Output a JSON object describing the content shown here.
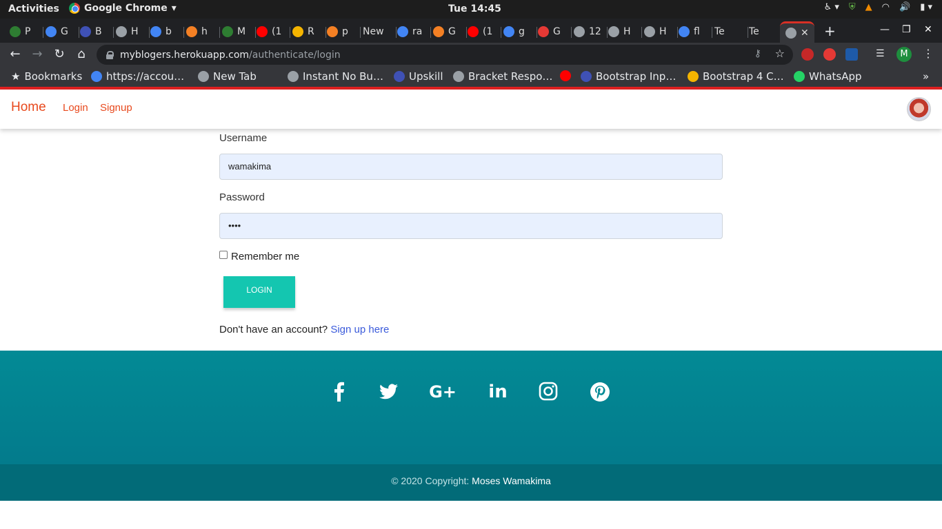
{
  "system_bar": {
    "activities": "Activities",
    "app_name": "Google Chrome",
    "clock": "Tue 14:45"
  },
  "browser": {
    "tabs": [
      {
        "label": "P",
        "fav_color": "#2e7d32"
      },
      {
        "label": "G",
        "fav_color": "#4285f4"
      },
      {
        "label": "B",
        "fav_color": "#3f51b5"
      },
      {
        "label": "H",
        "fav_color": "#9aa0a6"
      },
      {
        "label": "b",
        "fav_color": "#4285f4"
      },
      {
        "label": "h",
        "fav_color": "#f48024"
      },
      {
        "label": "M",
        "fav_color": "#2e7d32"
      },
      {
        "label": "(1",
        "fav_color": "#ff0000"
      },
      {
        "label": "R",
        "fav_color": "#f4b400"
      },
      {
        "label": "p",
        "fav_color": "#f48024"
      },
      {
        "label": "New",
        "fav_color": ""
      },
      {
        "label": "ra",
        "fav_color": "#4285f4"
      },
      {
        "label": "G",
        "fav_color": "#f48024"
      },
      {
        "label": "(1",
        "fav_color": "#ff0000"
      },
      {
        "label": "g",
        "fav_color": "#4285f4"
      },
      {
        "label": "G",
        "fav_color": "#e53935"
      },
      {
        "label": "12",
        "fav_color": "#9aa0a6"
      },
      {
        "label": "H",
        "fav_color": "#9aa0a6"
      },
      {
        "label": "H",
        "fav_color": "#9aa0a6"
      },
      {
        "label": "fl",
        "fav_color": "#4285f4"
      },
      {
        "label": "Te",
        "fav_color": ""
      },
      {
        "label": "Te",
        "fav_color": ""
      }
    ],
    "new_tab": "+",
    "url_host": "myblogers.herokuapp.com",
    "url_path": "/authenticate/login",
    "profile_initial": "M",
    "bookmarks_label": "Bookmarks",
    "bookmarks": [
      {
        "label": "https://accou…",
        "fav_color": "#4285f4"
      },
      {
        "label": "New Tab",
        "fav_color": "#9aa0a6"
      },
      {
        "label": "Instant No Bu…",
        "fav_color": "#9aa0a6"
      },
      {
        "label": "Upskill",
        "fav_color": "#3f51b5"
      },
      {
        "label": "Bracket Respo…",
        "fav_color": "#9aa0a6"
      },
      {
        "label": "",
        "fav_color": "#ff0000"
      },
      {
        "label": "Bootstrap Inp…",
        "fav_color": "#3f51b5"
      },
      {
        "label": "Bootstrap 4 C…",
        "fav_color": "#f4b400"
      },
      {
        "label": "WhatsApp",
        "fav_color": "#25d366"
      }
    ]
  },
  "navbar": {
    "brand": "Home",
    "links": [
      "Login",
      "Signup"
    ]
  },
  "form": {
    "username_label": "Username",
    "username_value": "wamakima",
    "password_label": "Password",
    "password_value": "••••",
    "remember_label": "Remember me",
    "remember_checked": false,
    "login_button": "LOGIN",
    "signup_prompt": "Don't have an account?",
    "signup_link": "Sign up here"
  },
  "footer": {
    "social_icons": [
      "facebook-icon",
      "twitter-icon",
      "google-plus-icon",
      "linkedin-icon",
      "instagram-icon",
      "pinterest-icon"
    ],
    "copyright_prefix": "© 2020 Copyright:",
    "copyright_name": "Moses Wamakima"
  },
  "colors": {
    "accent": "#e8491d",
    "button": "#14c6b0",
    "footer": "#038a95",
    "footer_bottom": "#026b78",
    "link": "#3b5bdb"
  }
}
